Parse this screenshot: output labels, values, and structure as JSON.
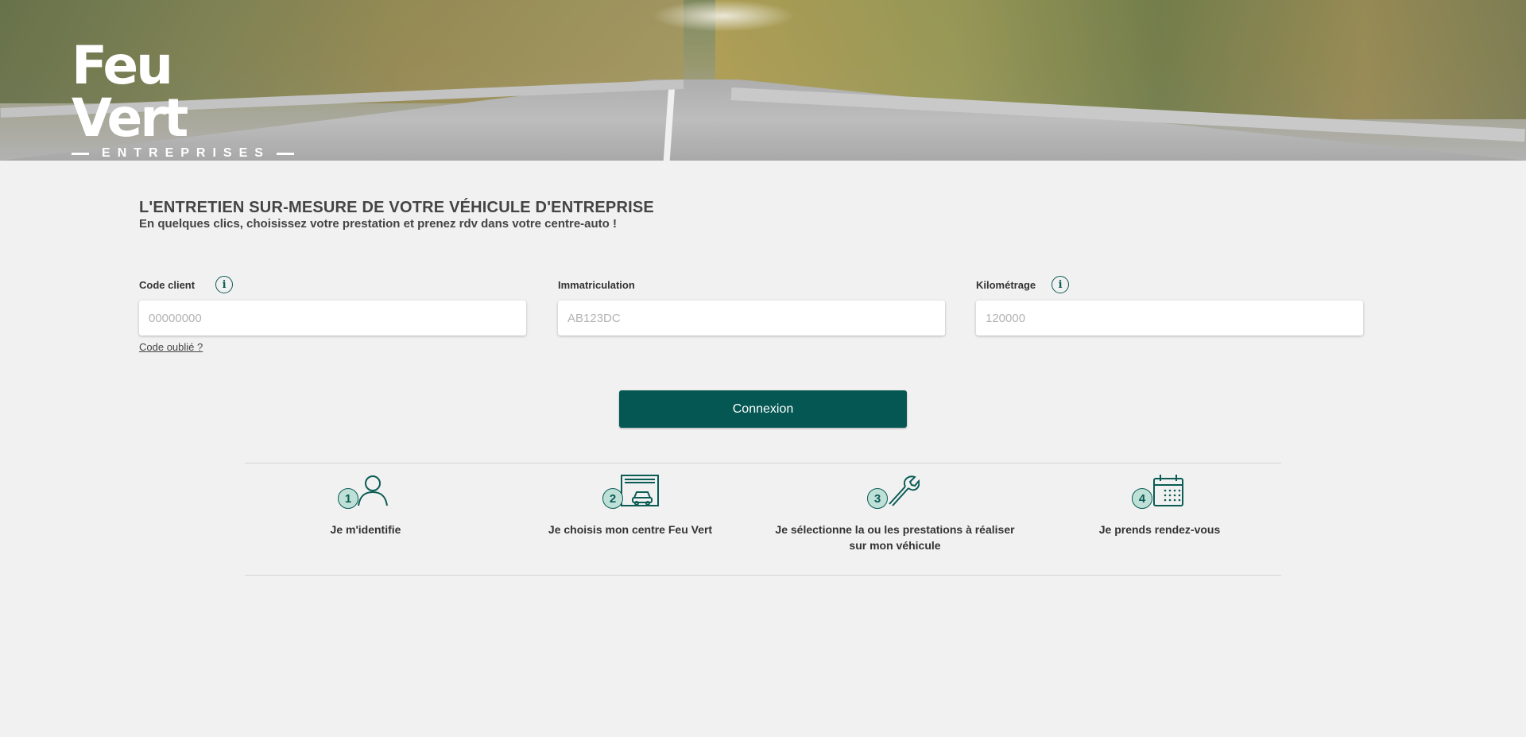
{
  "header": {
    "logo_brand": "Feu Vert",
    "logo_sub": "ENTREPRISES"
  },
  "headline": {
    "title": "L'ENTRETIEN SUR-MESURE DE VOTRE VÉHICULE D'ENTREPRISE",
    "subtitle": "En quelques clics, choisissez votre prestation et prenez rdv dans votre centre-auto !"
  },
  "form": {
    "client_code": {
      "label": "Code client",
      "placeholder": "00000000",
      "value": ""
    },
    "plate": {
      "label": "Immatriculation",
      "placeholder": "AB123DC",
      "value": ""
    },
    "mileage": {
      "label": "Kilométrage",
      "placeholder": "120000",
      "value": ""
    },
    "forgot_link": "Code oublié ?",
    "info_glyph": "i",
    "submit_label": "Connexion"
  },
  "steps": [
    {
      "number": "1",
      "icon": "user-icon",
      "label": "Je m'identifie"
    },
    {
      "number": "2",
      "icon": "garage-car-icon",
      "label": "Je choisis mon centre Feu Vert"
    },
    {
      "number": "3",
      "icon": "wrench-icon",
      "label": "Je sélectionne la ou les prestations à réaliser sur mon véhicule"
    },
    {
      "number": "4",
      "icon": "calendar-icon",
      "label": "Je prends rendez-vous"
    }
  ],
  "colors": {
    "primary": "#045753",
    "step_badge": "#bfe0d7",
    "background": "#f1f1f1"
  }
}
